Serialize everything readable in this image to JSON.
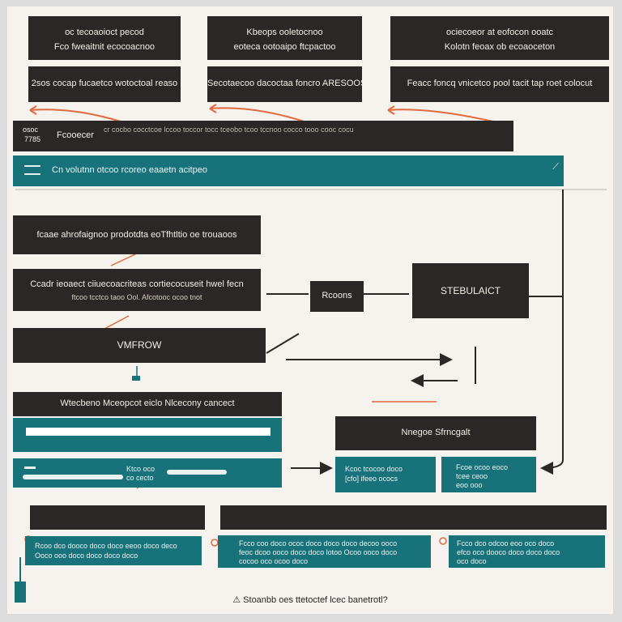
{
  "colors": {
    "dark": "#2b2726",
    "teal": "#17727a",
    "accent": "#e0693f",
    "background": "#f6f3ee"
  },
  "top_boxes": [
    {
      "line1": "oc tecoaoioct pecod",
      "line2": "Fco fweaitnit ecocoacnoo"
    },
    {
      "line1": "Kbeops ooletocnoo",
      "line2": "eoteca ootoaipo ftcpactoo"
    },
    {
      "line1": "ociecoeor at eofocon ooatc",
      "line2": "Kolotn feoax ob ecoaoceton"
    }
  ],
  "second_boxes": [
    {
      "text": "2sos cocap fucaetco wotoctoal reaso"
    },
    {
      "text": "Secotaecoo dacoctaa foncro ARESOOS"
    },
    {
      "text": "Feacc foncq vnicetco pool tacit tap roet colocut"
    }
  ],
  "header_bar": {
    "badge_top": "osoc",
    "badge_bottom": "7785",
    "title": "Fcooecer",
    "detail": "cr cocbo cocctcoe lccoo toccor tocc tceobo tcoo tccnoo cocco tooo cooc cocu"
  },
  "teal_bar": {
    "icon": "resize-icon",
    "text": "Cn volutnn otcoo rcoreo eaaetn acitpeo",
    "corner_icon": "resize-handle-icon"
  },
  "left_column": {
    "box1": "fcaae ahrofaignoo prodotdta eoTfhtltio oe trouaoos",
    "box2": {
      "line1": "Ccadr ieoaect ciiuecoacriteas cortiecocuseit hwel fecn",
      "line2": "ftcoo tcctco taoo Ool. Afcotooc ocoo tnot"
    },
    "box3": "VMFROW",
    "box4": "Wtecbeno Mceopcot eiclo Nlcecony cancect"
  },
  "center": {
    "process": "Rcoons",
    "test": "STEBULAICT"
  },
  "middle_right": {
    "header": "Nnegoe Sfrncgalt",
    "card1": {
      "line1": "Kcoc tcocoo doco",
      "line2": "[cfo] ifeeo ococs"
    },
    "card2": {
      "line1": "Fcoe ocoo eoco",
      "line2": "tcee ceoo",
      "line3": "eoo ooo"
    }
  },
  "input_row": {
    "line1": "Ktco oco",
    "line2": "co cecto"
  },
  "bottom": {
    "cards": [
      {
        "line1": "Rcoo dco dooco doco doco eeoo doco deco",
        "line2": "Ooco ooo doco doco doco doco"
      },
      {
        "line1": "Fcco coo doco ococ doco doco doco decoo ooco",
        "line2": "feoc dcoo ooco doco doco lotoo Ocoo ooco doco",
        "line3": "cocoo oco ocoo doco"
      },
      {
        "line1": "Fcco dco odcoo eoo oco doco",
        "line2": "efco oco dooco doco doco doco",
        "line3": "oco doco"
      }
    ],
    "caption": "Stoanbb oes ttetoctef lcec banetrotl?",
    "caption_icon": "warning-icon"
  }
}
